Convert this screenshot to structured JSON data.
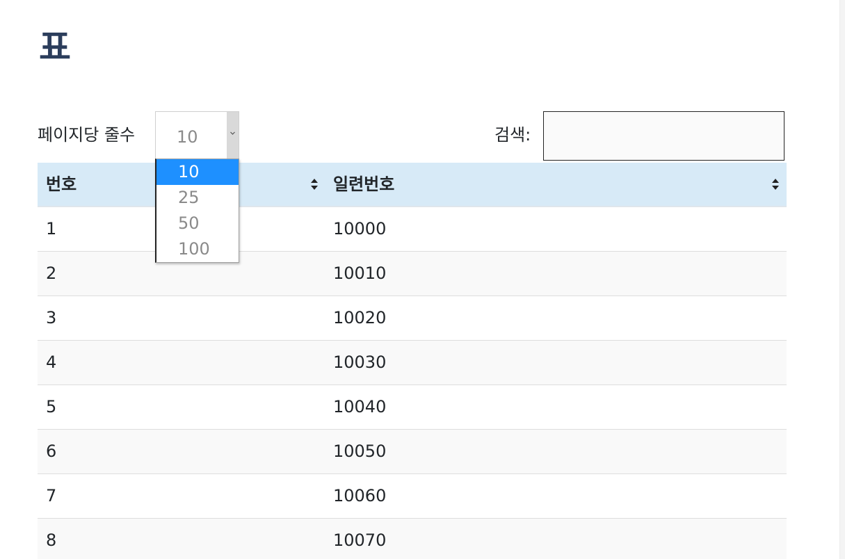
{
  "page": {
    "title": "표"
  },
  "length_menu": {
    "label": "페이지당 줄수",
    "selected": "10",
    "options": [
      "10",
      "25",
      "50",
      "100"
    ]
  },
  "search": {
    "label": "검색:",
    "value": "",
    "placeholder": ""
  },
  "table": {
    "headers": [
      "번호",
      "일련번호"
    ],
    "rows": [
      [
        "1",
        "10000"
      ],
      [
        "2",
        "10010"
      ],
      [
        "3",
        "10020"
      ],
      [
        "4",
        "10030"
      ],
      [
        "5",
        "10040"
      ],
      [
        "6",
        "10050"
      ],
      [
        "7",
        "10060"
      ],
      [
        "8",
        "10070"
      ]
    ]
  },
  "colors": {
    "title": "#2b3d5b",
    "header_bg": "#d7eaf7",
    "selected_option": "#1e90ff",
    "striped_row": "#f9f9f9"
  },
  "icons": {
    "sort": "sort-both-icon",
    "dropdown": "chevron-down-icon"
  }
}
